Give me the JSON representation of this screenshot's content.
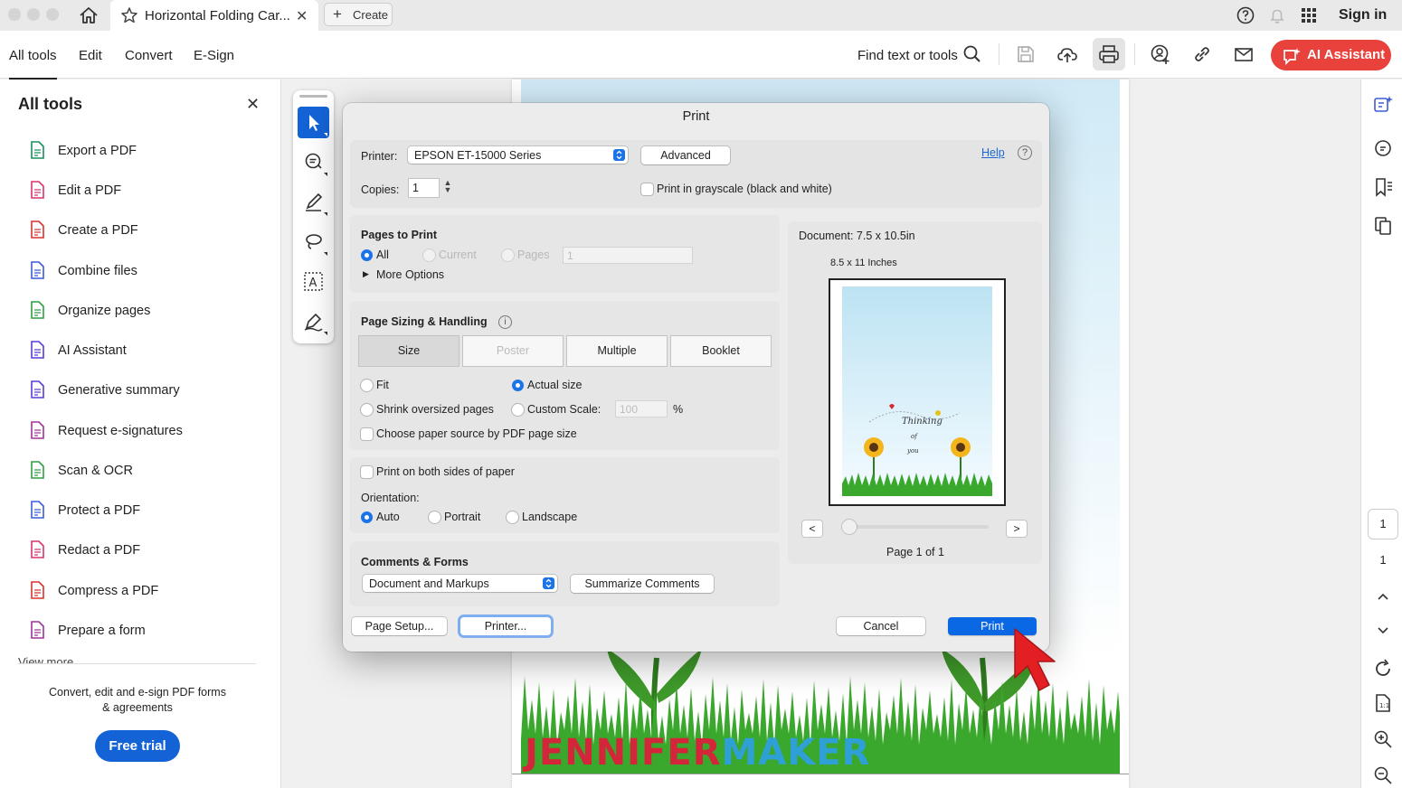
{
  "tabs": {
    "document_title": "Horizontal Folding Car...",
    "create_label": "Create"
  },
  "header": {
    "sign_in": "Sign in",
    "help_icon": "help-circle-icon",
    "bell_icon": "bell-icon",
    "apps_icon": "apps-grid-icon"
  },
  "menubar": {
    "items": [
      "All tools",
      "Edit",
      "Convert",
      "E-Sign"
    ],
    "find_label": "Find text or tools",
    "ai_assistant": "AI Assistant",
    "accent": "#e9413b"
  },
  "left_panel": {
    "title": "All tools",
    "tools": [
      {
        "label": "Export a PDF",
        "icon": "export-pdf-icon",
        "color": "#1a8f5c"
      },
      {
        "label": "Edit a PDF",
        "icon": "edit-pdf-icon",
        "color": "#d8346f"
      },
      {
        "label": "Create a PDF",
        "icon": "create-pdf-icon",
        "color": "#d8342f"
      },
      {
        "label": "Combine files",
        "icon": "combine-files-icon",
        "color": "#3b5bd9"
      },
      {
        "label": "Organize pages",
        "icon": "organize-pages-icon",
        "color": "#2f9e44"
      },
      {
        "label": "AI Assistant",
        "icon": "ai-assistant-icon",
        "color": "#5b3bd9"
      },
      {
        "label": "Generative summary",
        "icon": "generative-summary-icon",
        "color": "#5b3bd9"
      },
      {
        "label": "Request e-signatures",
        "icon": "request-esignatures-icon",
        "color": "#a0349a"
      },
      {
        "label": "Scan & OCR",
        "icon": "scan-ocr-icon",
        "color": "#2f9e44"
      },
      {
        "label": "Protect a PDF",
        "icon": "protect-pdf-icon",
        "color": "#3b5bd9"
      },
      {
        "label": "Redact a PDF",
        "icon": "redact-pdf-icon",
        "color": "#d8346f"
      },
      {
        "label": "Compress a PDF",
        "icon": "compress-pdf-icon",
        "color": "#d8342f"
      },
      {
        "label": "Prepare a form",
        "icon": "prepare-form-icon",
        "color": "#a0349a"
      }
    ],
    "view_more": "View more",
    "promo_line1": "Convert, edit and e-sign PDF forms",
    "promo_line2": "& agreements",
    "free_trial": "Free trial"
  },
  "right_rail": {
    "page_current": "1",
    "page_total": "1"
  },
  "watermark": {
    "part1": "JENNIFER",
    "part2": "MAKER"
  },
  "print_dialog": {
    "title": "Print",
    "printer_label": "Printer:",
    "printer_value": "EPSON ET-15000 Series",
    "advanced": "Advanced",
    "help": "Help",
    "copies_label": "Copies:",
    "copies_value": "1",
    "grayscale": "Print in grayscale (black and white)",
    "pages_to_print": {
      "title": "Pages to Print",
      "all": "All",
      "current": "Current",
      "pages": "Pages",
      "pages_value": "1",
      "more_options": "More Options",
      "selected": "All"
    },
    "sizing": {
      "title": "Page Sizing & Handling",
      "tabs": [
        "Size",
        "Poster",
        "Multiple",
        "Booklet"
      ],
      "selected_tab": "Size",
      "fit": "Fit",
      "actual_size": "Actual size",
      "shrink": "Shrink oversized pages",
      "custom_scale": "Custom Scale:",
      "scale_value": "100",
      "percent": "%",
      "paper_source": "Choose paper source by PDF page size",
      "selected": "Actual size"
    },
    "both_sides": "Print on both sides of paper",
    "orientation": {
      "label": "Orientation:",
      "options": [
        "Auto",
        "Portrait",
        "Landscape"
      ],
      "selected": "Auto"
    },
    "comments": {
      "title": "Comments & Forms",
      "value": "Document and Markups",
      "summarize": "Summarize Comments"
    },
    "preview": {
      "document_size": "Document: 7.5 x 10.5in",
      "paper_size": "8.5 x 11 Inches",
      "prev": "<",
      "next": ">",
      "page_label": "Page 1 of 1"
    },
    "buttons": {
      "page_setup": "Page Setup...",
      "printer": "Printer...",
      "cancel": "Cancel",
      "print": "Print"
    }
  }
}
